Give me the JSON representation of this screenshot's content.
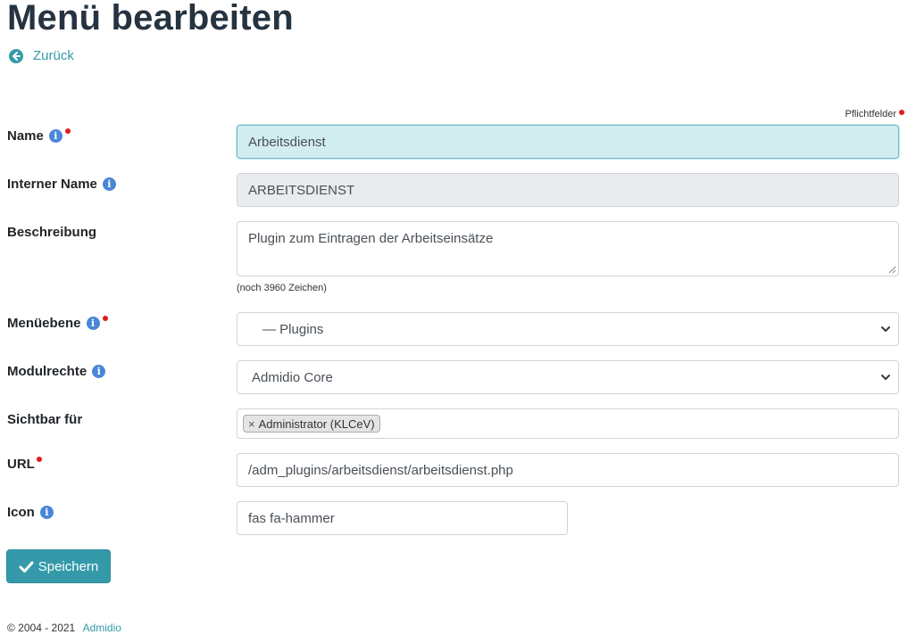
{
  "page": {
    "title": "Menü bearbeiten",
    "back_label": "Zurück",
    "required_note": "Pflichtfelder"
  },
  "form": {
    "name": {
      "label": "Name",
      "value": "Arbeitsdienst"
    },
    "internal_name": {
      "label": "Interner Name",
      "value": "ARBEITSDIENST"
    },
    "description": {
      "label": "Beschreibung",
      "value": "Plugin zum Eintragen der Arbeitseinsätze",
      "char_count": "(noch 3960 Zeichen)"
    },
    "menu_level": {
      "label": "Menüebene",
      "selected": "— Plugins"
    },
    "module_rights": {
      "label": "Modulrechte",
      "selected": "Admidio Core"
    },
    "visible_for": {
      "label": "Sichtbar für",
      "tags": [
        "Administrator (KLCeV)"
      ],
      "remove_symbol": "×"
    },
    "url": {
      "label": "URL",
      "value": "/adm_plugins/arbeitsdienst/arbeitsdienst.php"
    },
    "icon": {
      "label": "Icon",
      "value": "fas fa-hammer"
    }
  },
  "actions": {
    "save_label": "Speichern"
  },
  "footer": {
    "copyright": "© 2004 - 2021",
    "link_label": "Admidio"
  },
  "icons": {
    "back": "circle-arrow-left-icon",
    "info": "info-circle-icon",
    "select": "chevron-down-icon",
    "save": "check-icon"
  },
  "colors": {
    "accent": "#349aaa",
    "info": "#4a86d6",
    "required": "#e01b1b",
    "title": "#263340"
  }
}
